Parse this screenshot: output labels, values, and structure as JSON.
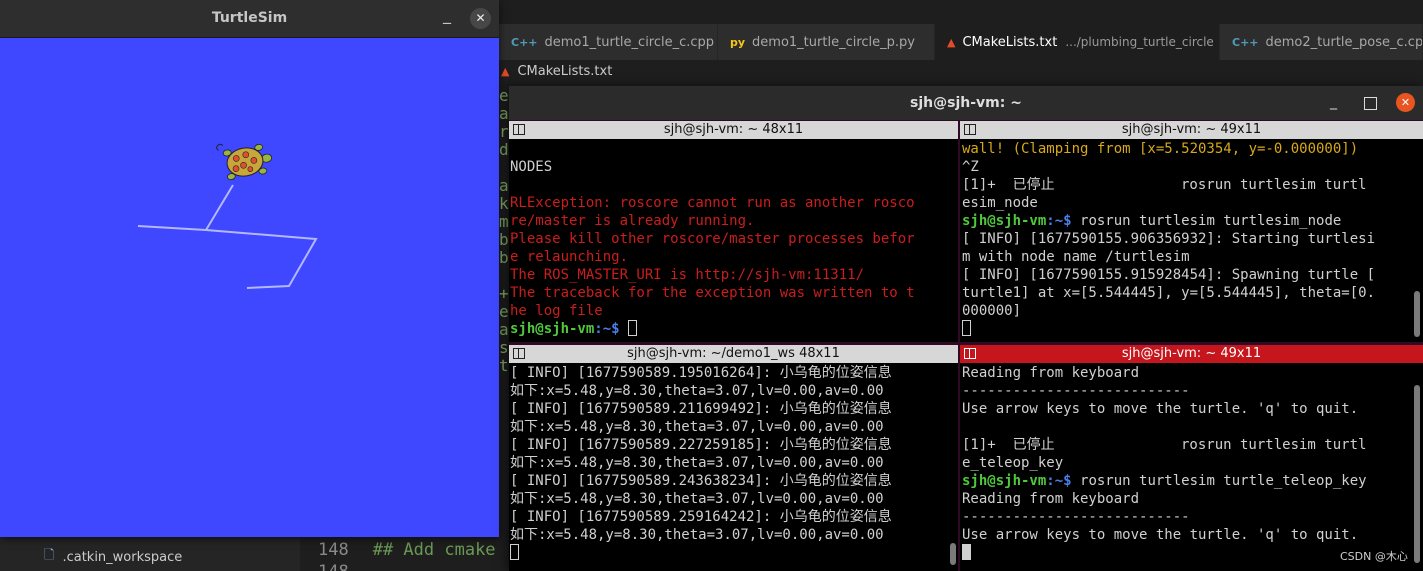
{
  "turtlesim": {
    "title": "TurtleSim",
    "minimize": "_",
    "close": "✕",
    "background_color": "#3f47ff",
    "path_color": "#b3b8ff"
  },
  "vscode": {
    "tabs": [
      {
        "icon": "C++",
        "label": "demo1_turtle_circle_c.cpp",
        "sub": ""
      },
      {
        "icon": "py",
        "label": "demo1_turtle_circle_p.py",
        "sub": ""
      },
      {
        "icon": "▲",
        "label": "CMakeLists.txt",
        "sub": ".../plumbing_turtle_circle",
        "close": "✕"
      },
      {
        "icon": "C++",
        "label": "demo2_turtle_pose_c.cpp",
        "sub": ""
      }
    ],
    "breadcrumb": "CMakeLists.txt",
    "gutter_chars": [
      "e",
      "a",
      "r",
      "d",
      "",
      "a",
      "k",
      "m",
      "b",
      "b",
      "",
      "+",
      "e",
      "a",
      "s",
      "t"
    ],
    "line148_num": "148",
    "line148_text": "## Add cmake",
    "line149_num": "148",
    "explorer_item": ".catkin_workspace"
  },
  "terminal": {
    "title": "sjh@sjh-vm: ~",
    "minimize": "_",
    "close": "✕",
    "panes": {
      "top_left": {
        "title": "sjh@sjh-vm: ~ 48x11",
        "lines": [
          {
            "t": "",
            "c": ""
          },
          {
            "t": "NODES",
            "c": ""
          },
          {
            "t": "",
            "c": ""
          },
          {
            "t": "RLException: roscore cannot run as another rosco",
            "c": "red"
          },
          {
            "t": "re/master is already running.",
            "c": "red"
          },
          {
            "t": "Please kill other roscore/master processes befor",
            "c": "red"
          },
          {
            "t": "e relaunching.",
            "c": "red"
          },
          {
            "t": "The ROS_MASTER_URI is http://sjh-vm:11311/",
            "c": "red"
          },
          {
            "t": "The traceback for the exception was written to t",
            "c": "red"
          },
          {
            "t": "he log file",
            "c": "red"
          }
        ],
        "prompt_user": "sjh@sjh-vm",
        "prompt_path": ":~$ "
      },
      "top_right": {
        "title": "sjh@sjh-vm: ~ 49x11",
        "lines": [
          {
            "t": "wall! (Clamping from [x=5.520354, y=-0.000000])",
            "c": "yel"
          },
          {
            "t": "^Z",
            "c": ""
          },
          {
            "t": "[1]+  已停止               rosrun turtlesim turtl",
            "c": ""
          },
          {
            "t": "esim_node",
            "c": ""
          }
        ],
        "cmd_user": "sjh@sjh-vm",
        "cmd_path": ":~$ ",
        "cmd": "rosrun turtlesim turtlesim_node",
        "lines2": [
          {
            "t": "[ INFO] [1677590155.906356932]: Starting turtlesi",
            "c": ""
          },
          {
            "t": "m with node name /turtlesim",
            "c": ""
          },
          {
            "t": "[ INFO] [1677590155.915928454]: Spawning turtle [",
            "c": ""
          },
          {
            "t": "turtle1] at x=[5.544445], y=[5.544445], theta=[0.",
            "c": ""
          },
          {
            "t": "000000]",
            "c": ""
          }
        ]
      },
      "bottom_left": {
        "title": "sjh@sjh-vm: ~/demo1_ws 48x11",
        "lines": [
          {
            "t": "[ INFO] [1677590589.195016264]: 小乌龟的位姿信息",
            "c": ""
          },
          {
            "t": "如下:x=5.48,y=8.30,theta=3.07,lv=0.00,av=0.00",
            "c": ""
          },
          {
            "t": "[ INFO] [1677590589.211699492]: 小乌龟的位姿信息",
            "c": ""
          },
          {
            "t": "如下:x=5.48,y=8.30,theta=3.07,lv=0.00,av=0.00",
            "c": ""
          },
          {
            "t": "[ INFO] [1677590589.227259185]: 小乌龟的位姿信息",
            "c": ""
          },
          {
            "t": "如下:x=5.48,y=8.30,theta=3.07,lv=0.00,av=0.00",
            "c": ""
          },
          {
            "t": "[ INFO] [1677590589.243638234]: 小乌龟的位姿信息",
            "c": ""
          },
          {
            "t": "如下:x=5.48,y=8.30,theta=3.07,lv=0.00,av=0.00",
            "c": ""
          },
          {
            "t": "[ INFO] [1677590589.259164242]: 小乌龟的位姿信息",
            "c": ""
          },
          {
            "t": "如下:x=5.48,y=8.30,theta=3.07,lv=0.00,av=0.00",
            "c": ""
          }
        ]
      },
      "bottom_right": {
        "title": "sjh@sjh-vm: ~ 49x11",
        "lines": [
          {
            "t": "Reading from keyboard",
            "c": ""
          },
          {
            "t": "---------------------------",
            "c": ""
          },
          {
            "t": "Use arrow keys to move the turtle. 'q' to quit.",
            "c": ""
          },
          {
            "t": "",
            "c": ""
          },
          {
            "t": "[1]+  已停止               rosrun turtlesim turtl",
            "c": ""
          },
          {
            "t": "e_teleop_key",
            "c": ""
          }
        ],
        "cmd_user": "sjh@sjh-vm",
        "cmd_path": ":~$ ",
        "cmd": "rosrun turtlesim turtle_teleop_key",
        "lines2": [
          {
            "t": "Reading from keyboard",
            "c": ""
          },
          {
            "t": "---------------------------",
            "c": ""
          },
          {
            "t": "Use arrow keys to move the turtle. 'q' to quit.",
            "c": ""
          }
        ]
      }
    }
  },
  "watermark": "CSDN @木心"
}
